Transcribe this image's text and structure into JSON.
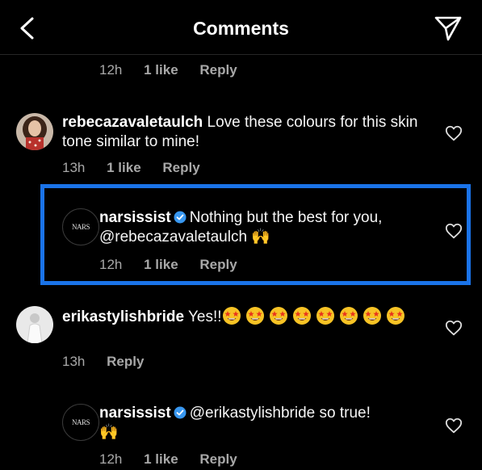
{
  "header": {
    "title": "Comments"
  },
  "top_meta": {
    "time": "12h",
    "likes": "1 like",
    "reply": "Reply"
  },
  "comment1": {
    "username": "rebecazavaletaulch",
    "text": "Love these colours for this skin tone similar to mine!",
    "time": "13h",
    "likes": "1 like",
    "reply": "Reply"
  },
  "comment2": {
    "username": "narsissist",
    "avatar_text": "NARS",
    "text_line1": "Nothing but the best for you,",
    "mention": "@rebecazavaletaulch",
    "emoji": "🙌",
    "time": "12h",
    "likes": "1 like",
    "reply": "Reply"
  },
  "comment3": {
    "username": "erikastylishbride",
    "text": "Yes!!",
    "emoji_count": 8,
    "time": "13h",
    "reply": "Reply"
  },
  "comment4": {
    "username": "narsissist",
    "avatar_text": "NARS",
    "mention": "@erikastylishbride",
    "text": "so true!",
    "emoji": "🙌",
    "time": "12h",
    "likes": "1 like",
    "reply": "Reply"
  },
  "colors": {
    "background": "#000000",
    "highlight": "#1a73e8",
    "meta": "#a8a8a8",
    "verified": "#3897f0"
  },
  "icons": [
    "back-arrow-icon",
    "send-icon",
    "heart-icon",
    "verified-icon",
    "star-struck-emoji",
    "raising-hands-emoji"
  ]
}
